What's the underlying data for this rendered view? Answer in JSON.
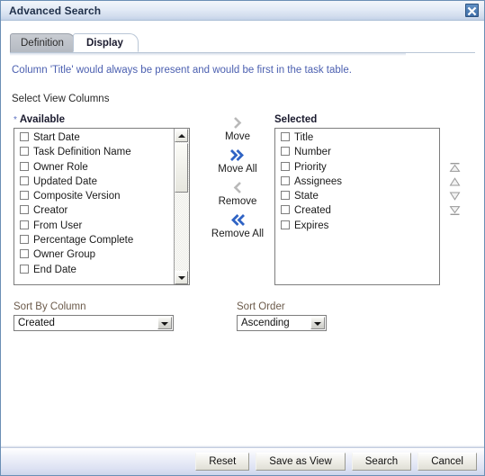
{
  "window": {
    "title": "Advanced Search",
    "close_icon": "close-icon"
  },
  "tabs": [
    {
      "label": "Definition",
      "active": false
    },
    {
      "label": "Display",
      "active": true
    }
  ],
  "content": {
    "hint": "Column 'Title' would always be present and would be first in the task table.",
    "section_label": "Select View Columns",
    "required_marker": "*"
  },
  "shuttle": {
    "available": {
      "header": "Available",
      "items": [
        "Start Date",
        "Task Definition Name",
        "Owner Role",
        "Updated Date",
        "Composite Version",
        "Creator",
        "From User",
        "Percentage Complete",
        "Owner Group",
        "End Date"
      ]
    },
    "selected": {
      "header": "Selected",
      "items": [
        "Title",
        "Number",
        "Priority",
        "Assignees",
        "State",
        "Created",
        "Expires"
      ]
    },
    "actions": [
      {
        "label": "Move",
        "icon": "chevron-right-icon",
        "enabled": false
      },
      {
        "label": "Move All",
        "icon": "chevron-double-right-icon",
        "enabled": true
      },
      {
        "label": "Remove",
        "icon": "chevron-left-icon",
        "enabled": false
      },
      {
        "label": "Remove All",
        "icon": "chevron-double-left-icon",
        "enabled": true
      }
    ],
    "reorder": [
      {
        "name": "move-to-top-button",
        "icon": "triangle-up-bar-icon"
      },
      {
        "name": "move-up-button",
        "icon": "triangle-up-icon"
      },
      {
        "name": "move-down-button",
        "icon": "triangle-down-icon"
      },
      {
        "name": "move-to-bottom-button",
        "icon": "triangle-down-bar-icon"
      }
    ]
  },
  "sort": {
    "column_label": "Sort By Column",
    "column_value": "Created",
    "order_label": "Sort Order",
    "order_value": "Ascending"
  },
  "footer": {
    "buttons": [
      {
        "label": "Reset"
      },
      {
        "label": "Save as View"
      },
      {
        "label": "Search"
      },
      {
        "label": "Cancel"
      }
    ]
  },
  "colors": {
    "hint_text": "#4b5fb0",
    "accent_blue": "#2a5fc0",
    "disabled_gray": "#b4b4b4",
    "titlebar": "#d2ddee",
    "label_brown": "#6b5a4a"
  }
}
